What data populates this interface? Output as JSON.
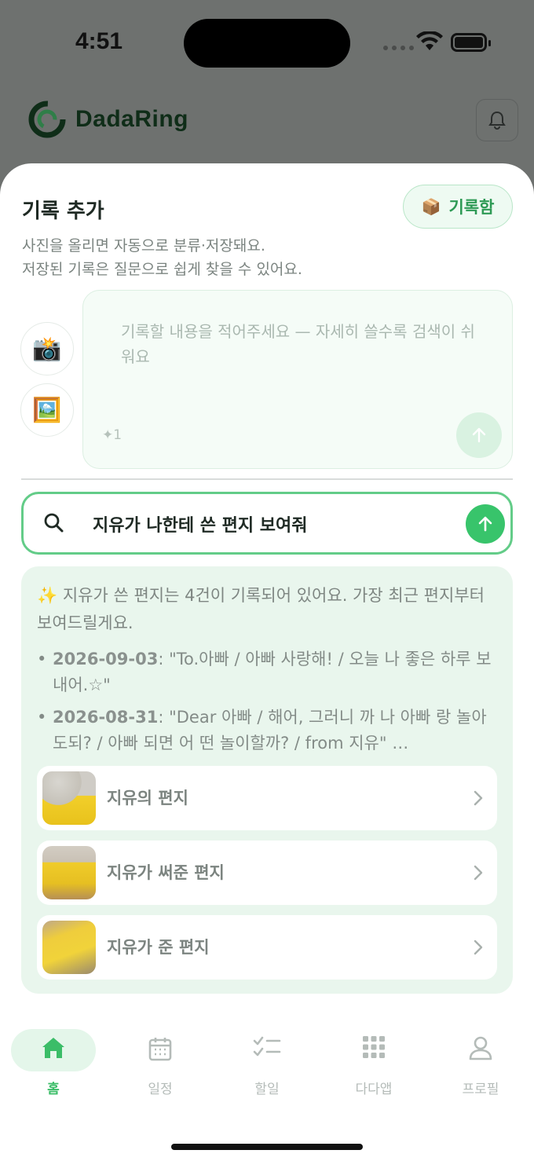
{
  "status": {
    "time": "4:51"
  },
  "header": {
    "logo_text": "DadaRing",
    "logo_colors": {
      "dark": "#0f2d18",
      "green": "#3bbd68"
    }
  },
  "sheet": {
    "title": "기록 추가",
    "archive_button": {
      "icon": "📦",
      "label": "기록함"
    },
    "subtitle_line1": "사진을 올리면 자동으로 분류·저장돼요.",
    "subtitle_line2": "저장된 기록은 질문으로 쉽게 찾을 수 있어요.",
    "camera_icon": "📸",
    "gallery_icon": "🖼️",
    "note": {
      "placeholder": "기록할 내용을 적어주세요 — 자세히 쓸수록 검색이 쉬워요",
      "counter": "✦1"
    }
  },
  "search": {
    "query": "지유가 나한테 쓴 편지 보여줘"
  },
  "answer": {
    "sparkle": "✨",
    "intro": "지유가 쓴 편지는 4건이 기록되어 있어요. 가장 최근 편지부터 보여드릴게요.",
    "items": [
      {
        "date": "2026-09-03",
        "text": ": \"To.아빠 / 아빠 사랑해! / 오늘 나 좋은 하루 보내어.☆\""
      },
      {
        "date": "2026-08-31",
        "text": ": \"Dear 아빠 / 해어, 그러니 까 나 아빠 랑 놀아도되? / 아빠 되면 어 떤 놀이할까? / from 지유\" …"
      }
    ],
    "results": [
      {
        "title": "지유의 편지"
      },
      {
        "title": "지유가 써준 편지"
      },
      {
        "title": "지유가 준 편지"
      }
    ]
  },
  "tabs": [
    {
      "label": "홈",
      "icon": "home-icon",
      "active": true
    },
    {
      "label": "일정",
      "icon": "calendar-icon",
      "active": false
    },
    {
      "label": "할일",
      "icon": "checklist-icon",
      "active": false
    },
    {
      "label": "다다앱",
      "icon": "grid-icon",
      "active": false
    },
    {
      "label": "프로필",
      "icon": "profile-icon",
      "active": false
    }
  ],
  "colors": {
    "accent": "#3bbd68",
    "accent_light": "#e9f6ed",
    "overlay": "#6e716f"
  }
}
